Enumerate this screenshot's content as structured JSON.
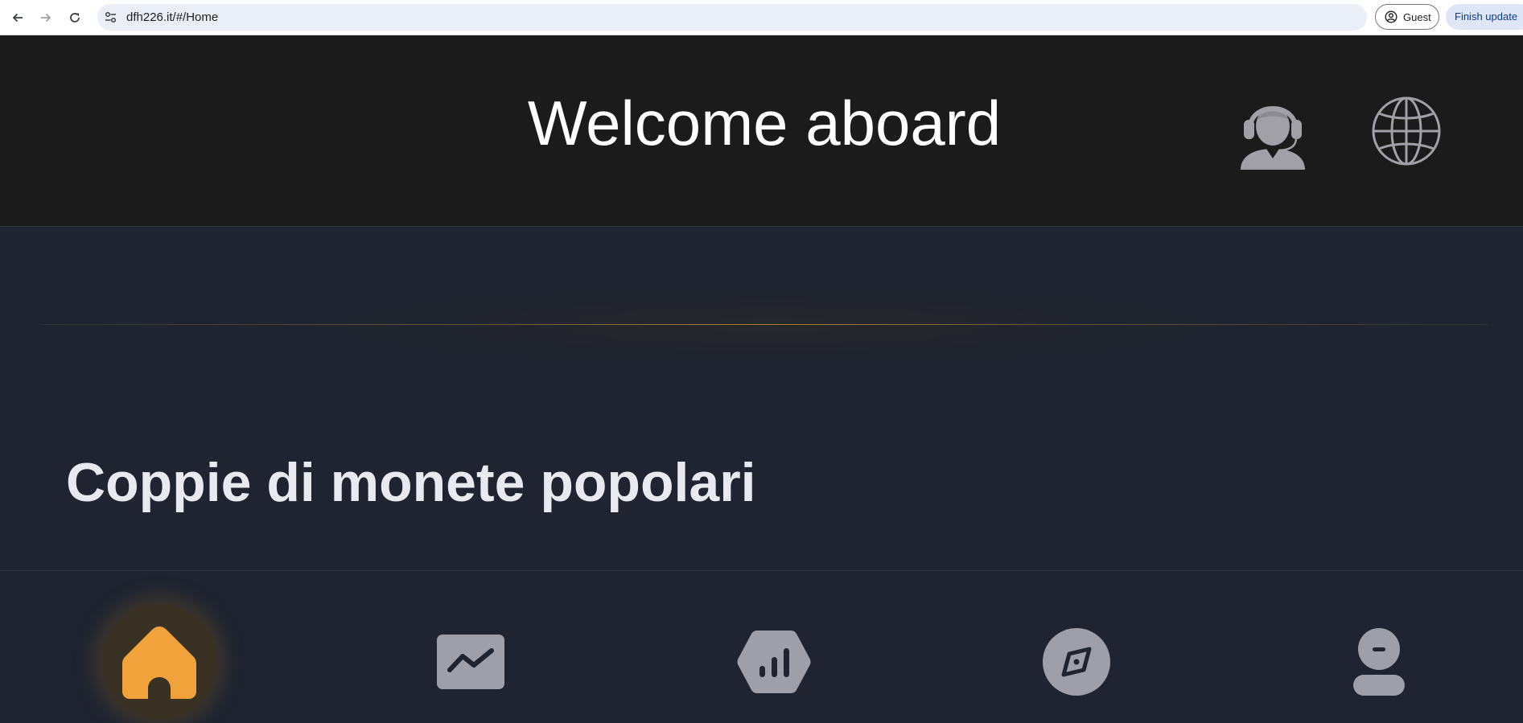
{
  "browser": {
    "url": "dfh226.it/#/Home",
    "profile_label": "Guest",
    "update_label": "Finish update",
    "icons": [
      "back-arrow-icon",
      "forward-arrow-icon",
      "reload-icon",
      "site-settings-icon",
      "account-circle-icon"
    ]
  },
  "header": {
    "title": "Welcome aboard",
    "icons": [
      "customer-support-icon",
      "globe-icon"
    ]
  },
  "section": {
    "title": "Coppie di monete popolari"
  },
  "tabbar": {
    "active_tab": "home",
    "tabs": [
      "home-icon",
      "market-trend-icon",
      "stats-hexagon-icon",
      "compass-icon",
      "profile-icon"
    ]
  },
  "colors": {
    "accent": "#f2a23a",
    "header_bg": "#1b1b1b",
    "page_bg": "#1f2430",
    "icon_gray": "#9e9fa8",
    "title_text": "#e8eaf0"
  }
}
